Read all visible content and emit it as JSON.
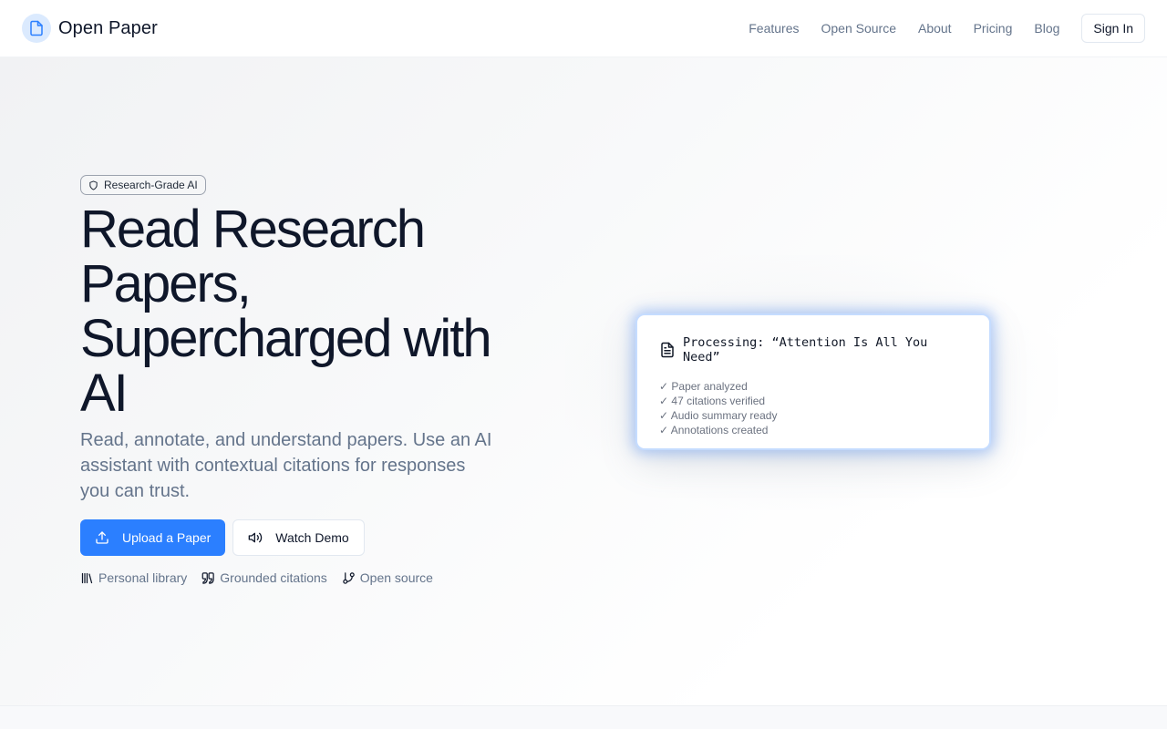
{
  "header": {
    "brand": "Open Paper",
    "nav": [
      "Features",
      "Open Source",
      "About",
      "Pricing",
      "Blog"
    ],
    "signin_label": "Sign In"
  },
  "hero": {
    "badge": "Research-Grade AI",
    "headline": "Read Research Papers, Supercharged with AI",
    "subtext": "Read, annotate, and understand papers. Use an AI assistant with contextual citations for responses you can trust.",
    "primary_cta": "Upload a Paper",
    "secondary_cta": "Watch Demo",
    "features": [
      {
        "icon": "library-icon",
        "label": "Personal library"
      },
      {
        "icon": "quote-icon",
        "label": "Grounded citations"
      },
      {
        "icon": "git-branch-icon",
        "label": "Open source"
      }
    ]
  },
  "card": {
    "title": "Processing: “Attention Is All You Need”",
    "items": [
      "✓ Paper analyzed",
      "✓ 47 citations verified",
      "✓ Audio summary ready",
      "✓ Annotations created"
    ]
  },
  "colors": {
    "accent": "#2b7fff",
    "text": "#0f172a",
    "muted": "#64748b"
  }
}
